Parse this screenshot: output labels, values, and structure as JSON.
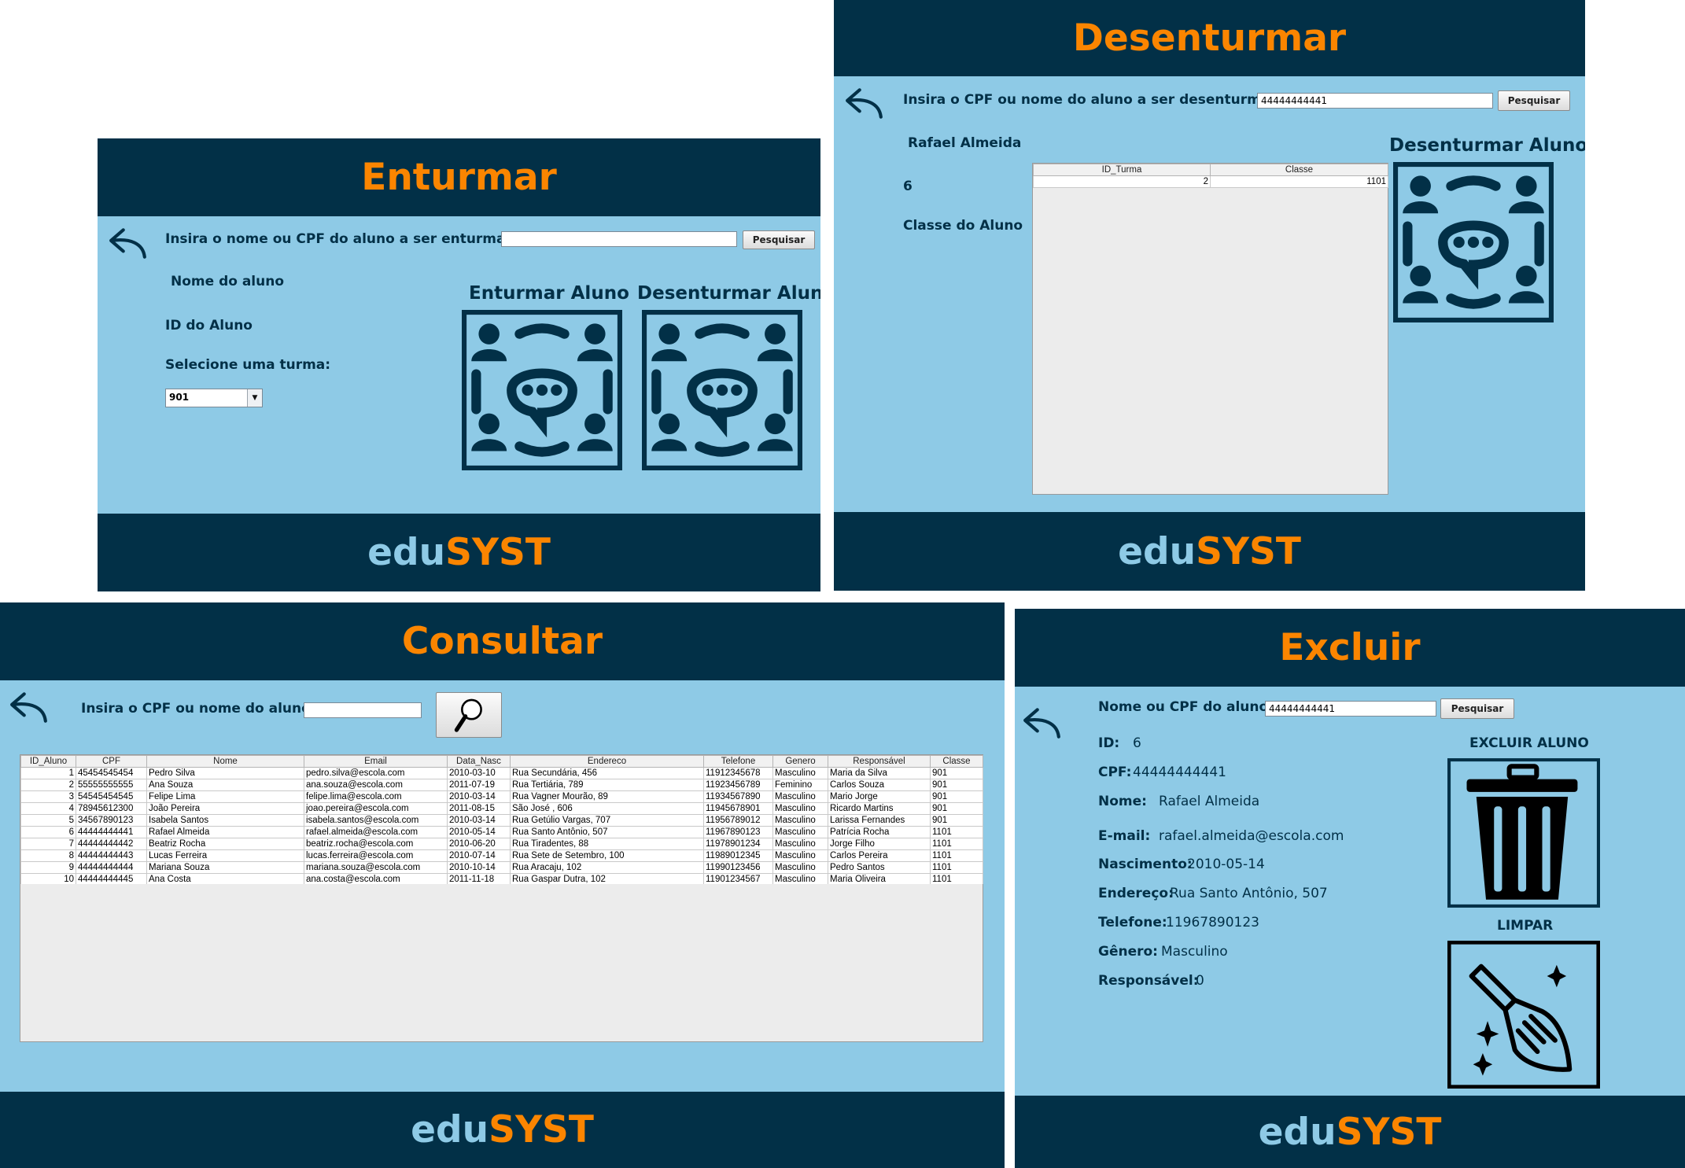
{
  "colors": {
    "dark": "#023047",
    "panel": "#8ecae6",
    "accent": "#fb8500"
  },
  "brand": {
    "part1": "edu",
    "part2": "SYST"
  },
  "enturmar": {
    "title": "Enturmar",
    "prompt": "Insira o nome ou CPF do aluno a ser enturmado:",
    "search_value": "",
    "search_button": "Pesquisar",
    "name_label": "Nome do aluno",
    "id_label": "ID do Aluno",
    "select_label": "Selecione uma turma:",
    "select_value": "901",
    "enturmar_title": "Enturmar Aluno",
    "desenturmar_title": "Desenturmar Aluno",
    "icon": "group-chat-icon"
  },
  "desenturmar": {
    "title": "Desenturmar",
    "prompt": "Insira o CPF ou nome do aluno a ser desenturmado",
    "search_value": "44444444441",
    "search_button": "Pesquisar",
    "student_name": "Rafael Almeida",
    "student_id": "6",
    "class_label": "Classe do Aluno",
    "action_title": "Desenturmar Aluno",
    "table": {
      "columns": [
        "ID_Turma",
        "Classe"
      ],
      "rows": [
        [
          "2",
          "1101"
        ]
      ]
    }
  },
  "consultar": {
    "title": "Consultar",
    "prompt": "Insira o CPF ou nome do aluno:",
    "search_value": "",
    "search_icon": "magnifier-icon",
    "table": {
      "columns": [
        "ID_Aluno",
        "CPF",
        "Nome",
        "Email",
        "Data_Nasc",
        "Endereco",
        "Telefone",
        "Genero",
        "Responsável",
        "Classe"
      ],
      "rows": [
        [
          "1",
          "45454545454",
          "Pedro Silva",
          "pedro.silva@escola.com",
          "2010-03-10",
          "Rua Secundária, 456",
          "11912345678",
          "Masculino",
          "Maria da Silva",
          "901"
        ],
        [
          "2",
          "55555555555",
          "Ana Souza",
          "ana.souza@escola.com",
          "2011-07-19",
          "Rua Tertiária, 789",
          "11923456789",
          "Feminino",
          "Carlos Souza",
          "901"
        ],
        [
          "3",
          "54545454545",
          "Felipe Lima",
          "felipe.lima@escola.com",
          "2010-03-14",
          "Rua Vagner Mourão, 89",
          "11934567890",
          "Masculino",
          "Mario Jorge",
          "901"
        ],
        [
          "4",
          "78945612300",
          "João Pereira",
          "joao.pereira@escola.com",
          "2011-08-15",
          "São José , 606",
          "11945678901",
          "Masculino",
          "Ricardo Martins",
          "901"
        ],
        [
          "5",
          "34567890123",
          "Isabela Santos",
          "isabela.santos@escola.com",
          "2010-03-14",
          "Rua Getúlio Vargas, 707",
          "11956789012",
          "Masculino",
          "Larissa Fernandes",
          "901"
        ],
        [
          "6",
          "44444444441",
          "Rafael Almeida",
          "rafael.almeida@escola.com",
          "2010-05-14",
          "Rua Santo Antônio, 507",
          "11967890123",
          "Masculino",
          "Patrícia Rocha",
          "1101"
        ],
        [
          "7",
          "44444444442",
          "Beatriz Rocha",
          "beatriz.rocha@escola.com",
          "2010-06-20",
          "Rua Tiradentes, 88",
          "11978901234",
          "Masculino",
          "Jorge Filho",
          "1101"
        ],
        [
          "8",
          "44444444443",
          "Lucas Ferreira",
          "lucas.ferreira@escola.com",
          "2010-07-14",
          "Rua Sete de Setembro, 100",
          "11989012345",
          "Masculino",
          "Carlos Pereira",
          "1101"
        ],
        [
          "9",
          "44444444444",
          "Mariana Souza",
          "mariana.souza@escola.com",
          "2010-10-14",
          "Rua Aracaju, 102",
          "11990123456",
          "Masculino",
          "Pedro Santos",
          "1101"
        ],
        [
          "10",
          "44444444445",
          "Ana Costa",
          "ana.costa@escola.com",
          "2011-11-18",
          "Rua Gaspar Dutra, 102",
          "11901234567",
          "Masculino",
          "Maria Oliveira",
          "1101"
        ]
      ]
    }
  },
  "excluir": {
    "title": "Excluir",
    "prompt": "Nome ou CPF do aluno:",
    "search_value": "44444444441",
    "search_button": "Pesquisar",
    "fields": {
      "id_label": "ID:",
      "id": "6",
      "cpf_label": "CPF:",
      "cpf": "44444444441",
      "nome_label": "Nome:",
      "nome": "Rafael Almeida",
      "email_label": "E-mail:",
      "email": "rafael.almeida@escola.com",
      "nasc_label": "Nascimento:",
      "nasc": "2010-05-14",
      "end_label": "Endereço:",
      "end": "Rua Santo Antônio, 507",
      "tel_label": "Telefone:",
      "tel": "11967890123",
      "gen_label": "Gênero:",
      "gen": "Masculino",
      "resp_label": "Responsável:",
      "resp": "0"
    },
    "delete_title": "EXCLUIR ALUNO",
    "clear_title": "LIMPAR",
    "delete_icon": "trash-can-icon",
    "clear_icon": "broom-icon"
  }
}
